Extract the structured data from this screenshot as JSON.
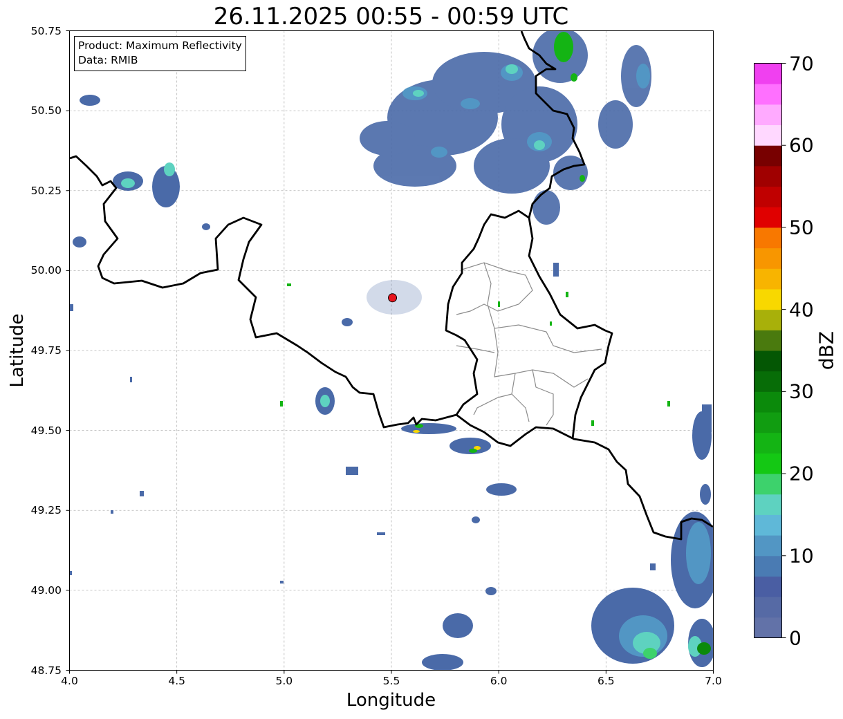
{
  "title": "26.11.2025 00:55 - 00:59 UTC",
  "info_box": {
    "product": "Product: Maximum Reflectivity",
    "data": "Data: RMIB"
  },
  "map": {
    "xlabel": "Longitude",
    "ylabel": "Latitude",
    "xlim": [
      4.0,
      7.0
    ],
    "ylim": [
      48.75,
      50.75
    ],
    "x_ticks": [
      "4.0",
      "4.5",
      "5.0",
      "5.5",
      "6.0",
      "6.5",
      "7.0"
    ],
    "y_ticks": [
      "48.75",
      "49.00",
      "49.25",
      "49.50",
      "49.75",
      "50.00",
      "50.25",
      "50.50",
      "50.75"
    ],
    "grid": true,
    "radar_site": {
      "lon": 5.505,
      "lat": 49.915,
      "color": "#e8141e"
    }
  },
  "colorbar": {
    "label": "dBZ",
    "range": [
      0,
      70
    ],
    "ticks": [
      "0",
      "10",
      "20",
      "30",
      "40",
      "50",
      "60",
      "70"
    ],
    "colors": [
      "#6272a8",
      "#566aa5",
      "#4a5ea3",
      "#4a7bb3",
      "#5296c4",
      "#5fb8d8",
      "#5ed2c0",
      "#3dd26c",
      "#14c814",
      "#14b414",
      "#119d11",
      "#0b8a0b",
      "#076d07",
      "#045704",
      "#4a7a0e",
      "#a8b00a",
      "#f8d800",
      "#f8b400",
      "#f89600",
      "#f87800",
      "#e00000",
      "#c00000",
      "#a00000",
      "#780000",
      "#ffd8ff",
      "#ffaaff",
      "#ff70ff",
      "#f040f0"
    ]
  }
}
